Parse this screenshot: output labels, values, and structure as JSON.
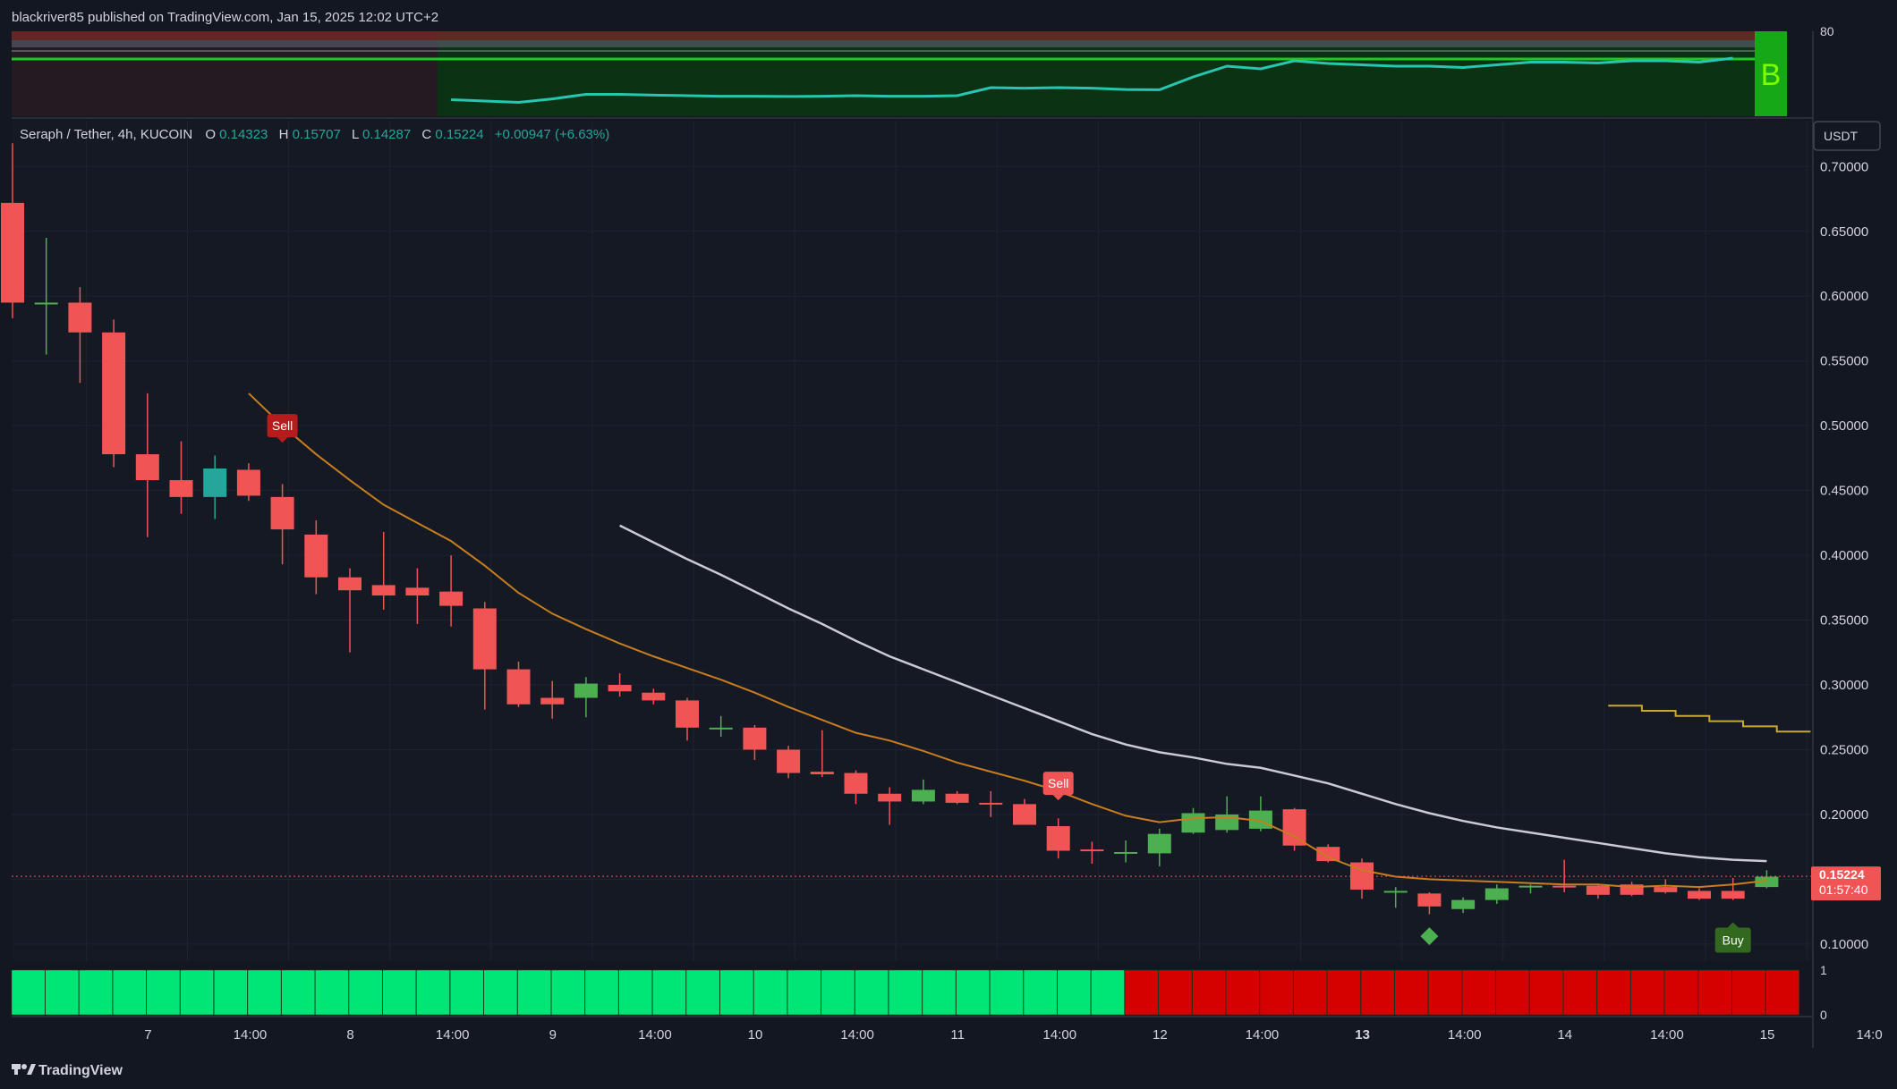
{
  "header": {
    "published": "blackriver85 published on TradingView.com, Jan 15, 2025 12:02 UTC+2"
  },
  "legend": {
    "symbol": "Seraph / Tether, 4h, KUCOIN",
    "o_label": "O",
    "o_value": "0.14323",
    "h_label": "H",
    "h_value": "0.15707",
    "l_label": "L",
    "l_value": "0.14287",
    "c_label": "C",
    "c_value": "0.15224",
    "change": "+0.00947 (+6.63%)"
  },
  "currency_button": "USDT",
  "last_price": {
    "value": "0.15224",
    "countdown": "01:57:40"
  },
  "footer_logo": "TradingView",
  "top_indicator": {
    "axis_label": "80",
    "signal_letter": "B"
  },
  "bottom_indicator": {
    "axis_top": "1",
    "axis_bottom": "0",
    "green_bars": 33,
    "red_bars": 20
  },
  "colors": {
    "background": "#131722",
    "up": "#4caf50",
    "down": "#f05454",
    "teal": "#26a69a",
    "ma_orange": "#c87d1e",
    "ma_white": "#c8cad4",
    "step_line": "#c8a832",
    "bar_green": "#00e676",
    "bar_red": "#d50000",
    "sell": "#b71c1c",
    "sell2": "#f05454",
    "buy": "#33691e",
    "last_price": "#f05454"
  },
  "chart_data": {
    "type": "candlestick",
    "title": "Seraph / Tether, 4h, KUCOIN",
    "ylim": [
      0.0868,
      0.7354
    ],
    "y_ticks": [
      0.7,
      0.65,
      0.6,
      0.55,
      0.5,
      0.45,
      0.4,
      0.35,
      0.3,
      0.25,
      0.2,
      0.15,
      0.1
    ],
    "y_tick_labels": [
      "0.70000",
      "0.65000",
      "0.60000",
      "0.55000",
      "0.50000",
      "0.45000",
      "0.40000",
      "0.35000",
      "0.30000",
      "0.25000",
      "0.20000",
      "0.15000",
      "0.10000"
    ],
    "x_tick_labels": [
      {
        "label": "7",
        "bar": 2,
        "bold": false
      },
      {
        "label": "14:00",
        "bar": 5,
        "bold": false
      },
      {
        "label": "8",
        "bar": 8,
        "bold": false
      },
      {
        "label": "14:00",
        "bar": 11,
        "bold": false
      },
      {
        "label": "9",
        "bar": 14,
        "bold": false
      },
      {
        "label": "14:00",
        "bar": 17,
        "bold": false
      },
      {
        "label": "10",
        "bar": 20,
        "bold": false
      },
      {
        "label": "14:00",
        "bar": 23,
        "bold": false
      },
      {
        "label": "11",
        "bar": 26,
        "bold": false
      },
      {
        "label": "14:00",
        "bar": 29,
        "bold": false
      },
      {
        "label": "12",
        "bar": 32,
        "bold": false
      },
      {
        "label": "14:00",
        "bar": 35,
        "bold": false
      },
      {
        "label": "13",
        "bar": 38,
        "bold": true
      },
      {
        "label": "14:00",
        "bar": 41,
        "bold": false
      },
      {
        "label": "14",
        "bar": 44,
        "bold": false
      },
      {
        "label": "14:00",
        "bar": 47,
        "bold": false
      },
      {
        "label": "15",
        "bar": 50,
        "bold": false
      },
      {
        "label": "14:0",
        "bar": 53,
        "bold": false
      }
    ],
    "candles": [
      {
        "o": 0.672,
        "h": 0.718,
        "l": 0.583,
        "c": 0.595
      },
      {
        "o": 0.595,
        "h": 0.645,
        "l": 0.555,
        "c": 0.595
      },
      {
        "o": 0.595,
        "h": 0.607,
        "l": 0.533,
        "c": 0.572
      },
      {
        "o": 0.572,
        "h": 0.582,
        "l": 0.468,
        "c": 0.478
      },
      {
        "o": 0.478,
        "h": 0.525,
        "l": 0.414,
        "c": 0.458
      },
      {
        "o": 0.458,
        "h": 0.488,
        "l": 0.432,
        "c": 0.445
      },
      {
        "o": 0.445,
        "h": 0.477,
        "l": 0.428,
        "c": 0.467,
        "teal": true
      },
      {
        "o": 0.466,
        "h": 0.471,
        "l": 0.442,
        "c": 0.446
      },
      {
        "o": 0.445,
        "h": 0.455,
        "l": 0.393,
        "c": 0.42
      },
      {
        "o": 0.416,
        "h": 0.427,
        "l": 0.37,
        "c": 0.383
      },
      {
        "o": 0.383,
        "h": 0.39,
        "l": 0.325,
        "c": 0.373
      },
      {
        "o": 0.377,
        "h": 0.418,
        "l": 0.358,
        "c": 0.369
      },
      {
        "o": 0.375,
        "h": 0.39,
        "l": 0.347,
        "c": 0.369
      },
      {
        "o": 0.372,
        "h": 0.4,
        "l": 0.345,
        "c": 0.361
      },
      {
        "o": 0.359,
        "h": 0.364,
        "l": 0.281,
        "c": 0.312
      },
      {
        "o": 0.312,
        "h": 0.318,
        "l": 0.283,
        "c": 0.285
      },
      {
        "o": 0.29,
        "h": 0.303,
        "l": 0.274,
        "c": 0.285
      },
      {
        "o": 0.29,
        "h": 0.306,
        "l": 0.275,
        "c": 0.301
      },
      {
        "o": 0.3,
        "h": 0.309,
        "l": 0.291,
        "c": 0.295
      },
      {
        "o": 0.294,
        "h": 0.297,
        "l": 0.285,
        "c": 0.288
      },
      {
        "o": 0.288,
        "h": 0.29,
        "l": 0.257,
        "c": 0.267
      },
      {
        "o": 0.267,
        "h": 0.276,
        "l": 0.26,
        "c": 0.267
      },
      {
        "o": 0.267,
        "h": 0.269,
        "l": 0.242,
        "c": 0.25
      },
      {
        "o": 0.25,
        "h": 0.253,
        "l": 0.228,
        "c": 0.232
      },
      {
        "o": 0.233,
        "h": 0.265,
        "l": 0.229,
        "c": 0.231
      },
      {
        "o": 0.232,
        "h": 0.234,
        "l": 0.208,
        "c": 0.216
      },
      {
        "o": 0.216,
        "h": 0.221,
        "l": 0.192,
        "c": 0.21
      },
      {
        "o": 0.21,
        "h": 0.227,
        "l": 0.208,
        "c": 0.219
      },
      {
        "o": 0.216,
        "h": 0.218,
        "l": 0.208,
        "c": 0.209
      },
      {
        "o": 0.209,
        "h": 0.218,
        "l": 0.198,
        "c": 0.208
      },
      {
        "o": 0.208,
        "h": 0.212,
        "l": 0.197,
        "c": 0.192
      },
      {
        "o": 0.191,
        "h": 0.197,
        "l": 0.166,
        "c": 0.172
      },
      {
        "o": 0.173,
        "h": 0.179,
        "l": 0.162,
        "c": 0.172
      },
      {
        "o": 0.17,
        "h": 0.18,
        "l": 0.163,
        "c": 0.171
      },
      {
        "o": 0.17,
        "h": 0.189,
        "l": 0.16,
        "c": 0.185
      },
      {
        "o": 0.186,
        "h": 0.205,
        "l": 0.185,
        "c": 0.201
      },
      {
        "o": 0.188,
        "h": 0.214,
        "l": 0.186,
        "c": 0.2
      },
      {
        "o": 0.189,
        "h": 0.214,
        "l": 0.187,
        "c": 0.203
      },
      {
        "o": 0.204,
        "h": 0.205,
        "l": 0.172,
        "c": 0.176
      },
      {
        "o": 0.175,
        "h": 0.177,
        "l": 0.163,
        "c": 0.164
      },
      {
        "o": 0.163,
        "h": 0.166,
        "l": 0.135,
        "c": 0.142
      },
      {
        "o": 0.141,
        "h": 0.144,
        "l": 0.128,
        "c": 0.141
      },
      {
        "o": 0.139,
        "h": 0.14,
        "l": 0.123,
        "c": 0.129
      },
      {
        "o": 0.127,
        "h": 0.136,
        "l": 0.124,
        "c": 0.134
      },
      {
        "o": 0.134,
        "h": 0.146,
        "l": 0.131,
        "c": 0.143
      },
      {
        "o": 0.144,
        "h": 0.146,
        "l": 0.139,
        "c": 0.145
      },
      {
        "o": 0.145,
        "h": 0.165,
        "l": 0.14,
        "c": 0.144
      },
      {
        "o": 0.145,
        "h": 0.146,
        "l": 0.135,
        "c": 0.138
      },
      {
        "o": 0.146,
        "h": 0.148,
        "l": 0.137,
        "c": 0.138
      },
      {
        "o": 0.144,
        "h": 0.15,
        "l": 0.139,
        "c": 0.14
      },
      {
        "o": 0.141,
        "h": 0.143,
        "l": 0.134,
        "c": 0.135
      },
      {
        "o": 0.141,
        "h": 0.151,
        "l": 0.134,
        "c": 0.135
      },
      {
        "o": 0.144,
        "h": 0.157,
        "l": 0.143,
        "c": 0.152
      }
    ],
    "series": [
      {
        "values": [
          0.525,
          0.5,
          0.478,
          0.458,
          0.439,
          0.425,
          0.411,
          0.392,
          0.371,
          0.355,
          0.343,
          0.332,
          0.322,
          0.313,
          0.304,
          0.294,
          0.283,
          0.273,
          0.263,
          0.257,
          0.249,
          0.24,
          0.233,
          0.226,
          0.218,
          0.208,
          0.199,
          0.194,
          0.197,
          0.198,
          0.195,
          0.183,
          0.167,
          0.157,
          0.152,
          0.15,
          0.149,
          0.148,
          0.147,
          0.146,
          0.146,
          0.144,
          0.145,
          0.144,
          0.146,
          0.149
        ],
        "start_bar": 7
      },
      {
        "values": [
          0.423,
          0.41,
          0.397,
          0.385,
          0.372,
          0.359,
          0.347,
          0.334,
          0.322,
          0.312,
          0.302,
          0.292,
          0.282,
          0.272,
          0.262,
          0.254,
          0.248,
          0.244,
          0.239,
          0.236,
          0.23,
          0.224,
          0.216,
          0.208,
          0.201,
          0.195,
          0.19,
          0.186,
          0.182,
          0.178,
          0.174,
          0.17,
          0.167,
          0.165,
          0.164
        ],
        "start_bar": 18
      },
      {
        "values": [
          0.284,
          0.284,
          0.28,
          0.28,
          0.276,
          0.276,
          0.272,
          0.272,
          0.268,
          0.268,
          0.264,
          0.264
        ],
        "start_bar": 47.3,
        "step": 0.5
      }
    ],
    "signals": [
      {
        "label": "Sell",
        "bar": 8,
        "price": 0.5
      },
      {
        "label": "Sell",
        "bar": 31,
        "price": 0.224
      },
      {
        "label": "Buy",
        "bar": 51,
        "price": 0.103
      }
    ],
    "diamond": {
      "bar": 42,
      "price": 0.106
    },
    "top_indicator_line": [
      0.35,
      0.3,
      0.25,
      0.38,
      0.55,
      0.55,
      0.52,
      0.5,
      0.48,
      0.48,
      0.47,
      0.48,
      0.5,
      0.48,
      0.48,
      0.5,
      0.8,
      0.78,
      0.8,
      0.78,
      0.73,
      0.72,
      1.2,
      1.6,
      1.5,
      1.8,
      1.7,
      1.65,
      1.6,
      1.6,
      1.55,
      1.65,
      1.75,
      1.75,
      1.72,
      1.8,
      1.8,
      1.75,
      1.9
    ],
    "top_indicator_start_bar": 13
  }
}
